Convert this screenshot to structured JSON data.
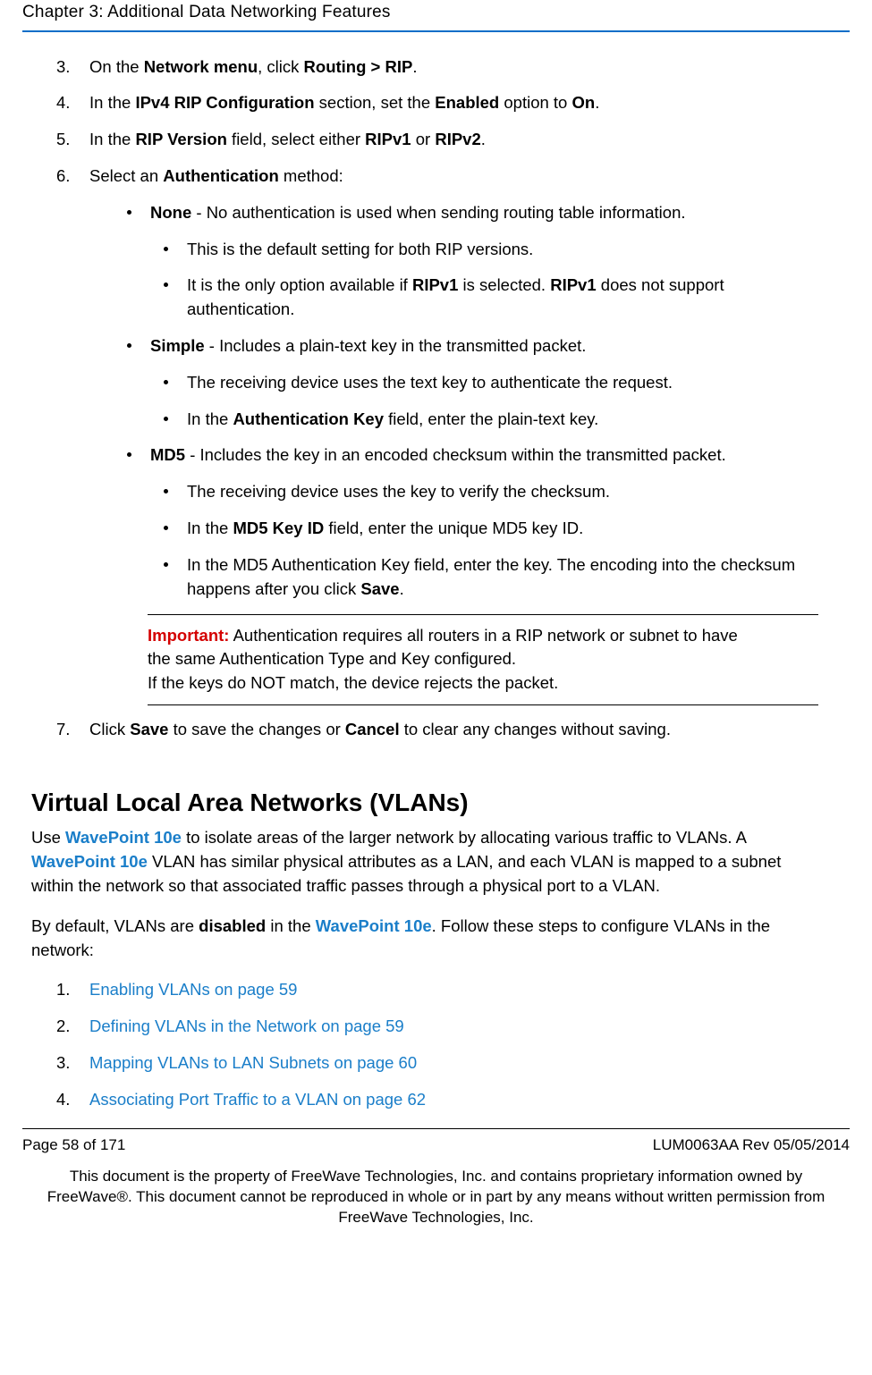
{
  "header": {
    "chapter": "Chapter 3: Additional Data Networking Features"
  },
  "steps": {
    "s3": {
      "t1": "On the ",
      "b1": "Network menu",
      "t2": ", click ",
      "b2": "Routing > RIP",
      "t3": "."
    },
    "s4": {
      "t1": "In the ",
      "b1": "IPv4 RIP Configuration",
      "t2": " section, set the ",
      "b2": "Enabled",
      "t3": " option to ",
      "b3": "On",
      "t4": "."
    },
    "s5": {
      "t1": "In the ",
      "b1": "RIP Version",
      "t2": " field, select either ",
      "b2": "RIPv1",
      "t3": " or ",
      "b3": "RIPv2",
      "t4": "."
    },
    "s6": {
      "t1": "Select an ",
      "b1": "Authentication",
      "t2": " method:"
    },
    "auth_none": {
      "b1": "None",
      "t1": " - No authentication is used when sending routing table information.",
      "sub1": "This is the default setting for both RIP versions.",
      "sub2_t1": "It is the only option available if ",
      "sub2_b1": "RIPv1",
      "sub2_t2": " is selected. ",
      "sub2_b2": "RIPv1",
      "sub2_t3": " does not support authentication."
    },
    "auth_simple": {
      "b1": "Simple",
      "t1": " - Includes a plain-text key in the transmitted packet.",
      "sub1": "The receiving device uses the text key to authenticate the request.",
      "sub2_t1": "In the ",
      "sub2_b1": "Authentication Key",
      "sub2_t2": " field, enter the plain-text key."
    },
    "auth_md5": {
      "b1": "MD5",
      "t1": " - Includes the key in an encoded checksum within the transmitted packet.",
      "sub1": "The receiving device uses the key to verify the checksum.",
      "sub2_t1": "In the ",
      "sub2_b1": "MD5 Key ID",
      "sub2_t2": " field, enter the unique MD5 key ID.",
      "sub3_t1": "In the MD5 Authentication Key field, enter the key. The encoding into the checksum happens after you click ",
      "sub3_b1": "Save",
      "sub3_t2": "."
    },
    "important": {
      "label": "Important:",
      "t1": " Authentication requires all routers in a RIP network or subnet to have the same Authentication Type and Key configured.",
      "t2": "If the keys do NOT match, the device rejects the packet."
    },
    "s7": {
      "t1": "Click ",
      "b1": "Save",
      "t2": " to save the changes or ",
      "b2": "Cancel",
      "t3": " to clear any changes without saving."
    }
  },
  "vlan": {
    "title": "Virtual Local Area Networks (VLANs)",
    "product": "WavePoint 10e",
    "p1_t1": "Use ",
    "p1_t2": " to isolate areas of the larger network by allocating various traffic to VLANs. A ",
    "p1_t3": " VLAN has similar physical attributes as a LAN, and each VLAN is mapped to a subnet within the network so that associated traffic passes through a physical port to a VLAN.",
    "p2_t1": "By default, VLANs are ",
    "p2_b1": "disabled",
    "p2_t2": " in the ",
    "p2_t3": ". Follow these steps to configure VLANs in the network:",
    "links": [
      "Enabling VLANs on page 59",
      "Defining VLANs in the Network on page 59",
      "Mapping VLANs to LAN Subnets on page 60",
      "Associating Port Traffic to a VLAN on page 62"
    ]
  },
  "footer": {
    "page": "Page 58 of 171",
    "docid": "LUM0063AA Rev 05/05/2014",
    "disclaimer": "This document is the property of FreeWave Technologies, Inc. and contains proprietary information owned by FreeWave®. This document cannot be reproduced in whole or in part by any means without written permission from FreeWave Technologies, Inc."
  }
}
